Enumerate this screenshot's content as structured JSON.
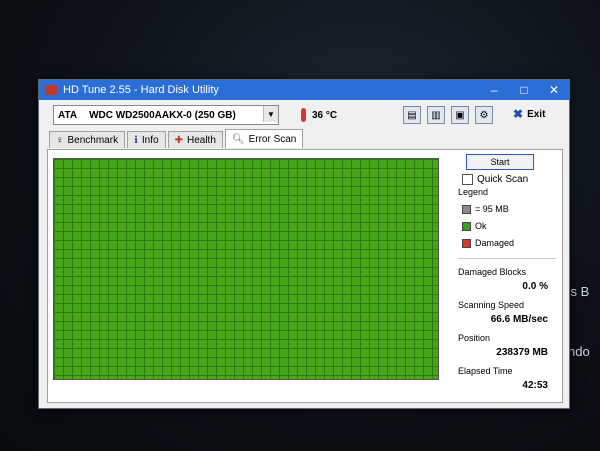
{
  "window": {
    "title": "HD Tune 2.55 - Hard Disk Utility"
  },
  "toolbar": {
    "drive_prefix": "ATA",
    "drive_name": "WDC WD2500AAKX-0 (250 GB)",
    "temperature": "36 °C",
    "exit_label": "Exit"
  },
  "tabs": [
    {
      "label": "Benchmark"
    },
    {
      "label": "Info"
    },
    {
      "label": "Health"
    },
    {
      "label": "Error Scan"
    }
  ],
  "scan": {
    "start_label": "Start",
    "quick_scan_label": "Quick Scan",
    "quick_scan_checked": false,
    "legend_title": "Legend",
    "legend": [
      {
        "label": "= 95 MB",
        "color": "#8a8a8a"
      },
      {
        "label": "Ok",
        "color": "#3aa020"
      },
      {
        "label": "Damaged",
        "color": "#d63a2a"
      }
    ],
    "stats": {
      "damaged_blocks_label": "Damaged Blocks",
      "damaged_blocks_value": "0.0 %",
      "scanning_speed_label": "Scanning Speed",
      "scanning_speed_value": "66.6 MB/sec",
      "position_label": "Position",
      "position_value": "238379 MB",
      "elapsed_label": "Elapsed Time",
      "elapsed_value": "42:53"
    }
  },
  "desktop_text": [
    "'s B",
    "ndo"
  ],
  "colors": {
    "titlebar": "#2b6fd6",
    "block_ok": "#46a51a"
  }
}
